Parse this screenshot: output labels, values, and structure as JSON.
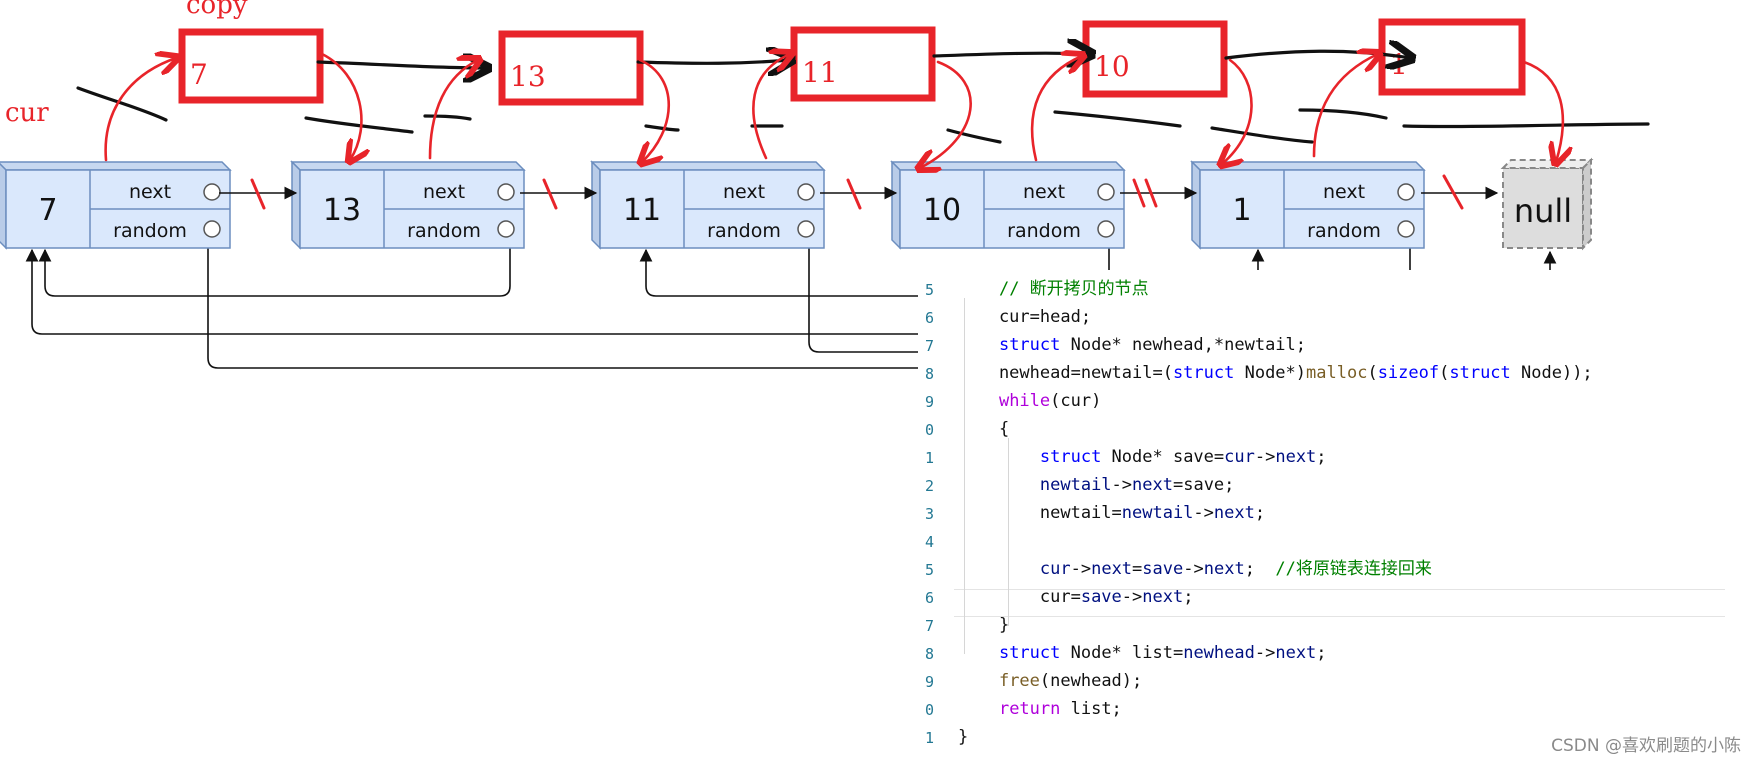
{
  "annotations": {
    "copy_label": "copy",
    "cur_label": "cur"
  },
  "copies": [
    {
      "value": "7"
    },
    {
      "value": "13"
    },
    {
      "value": "11"
    },
    {
      "value": "10"
    },
    {
      "value": "1"
    }
  ],
  "nodes": [
    {
      "value": "7",
      "next_label": "next",
      "random_label": "random"
    },
    {
      "value": "13",
      "next_label": "next",
      "random_label": "random"
    },
    {
      "value": "11",
      "next_label": "next",
      "random_label": "random"
    },
    {
      "value": "10",
      "next_label": "next",
      "random_label": "random"
    },
    {
      "value": "1",
      "next_label": "next",
      "random_label": "random"
    }
  ],
  "null_label": "null",
  "code": {
    "line_numbers": [
      "5",
      "6",
      "7",
      "8",
      "9",
      "0",
      "1",
      "2",
      "3",
      "4",
      "5",
      "6",
      "7",
      "8",
      "9",
      "0",
      "1"
    ],
    "lines": [
      [
        {
          "t": "    "
        },
        {
          "t": "// 断开拷贝的节点",
          "c": "cm"
        }
      ],
      [
        {
          "t": "    cur=head;"
        }
      ],
      [
        {
          "t": "    "
        },
        {
          "t": "struct",
          "c": "kw"
        },
        {
          "t": " Node* newhead,*newtail;"
        }
      ],
      [
        {
          "t": "    newhead=newtail=("
        },
        {
          "t": "struct",
          "c": "kw"
        },
        {
          "t": " Node*)"
        },
        {
          "t": "malloc",
          "c": "fn"
        },
        {
          "t": "("
        },
        {
          "t": "sizeof",
          "c": "kw"
        },
        {
          "t": "("
        },
        {
          "t": "struct",
          "c": "kw"
        },
        {
          "t": " Node));"
        }
      ],
      [
        {
          "t": "    "
        },
        {
          "t": "while",
          "c": "kw2"
        },
        {
          "t": "(cur)"
        }
      ],
      [
        {
          "t": "    {"
        }
      ],
      [
        {
          "t": "        "
        },
        {
          "t": "struct",
          "c": "kw"
        },
        {
          "t": " Node* save="
        },
        {
          "t": "cur",
          "c": "var"
        },
        {
          "t": "->"
        },
        {
          "t": "next",
          "c": "var"
        },
        {
          "t": ";"
        }
      ],
      [
        {
          "t": "        "
        },
        {
          "t": "newtail",
          "c": "var"
        },
        {
          "t": "->"
        },
        {
          "t": "next",
          "c": "var"
        },
        {
          "t": "=save;"
        }
      ],
      [
        {
          "t": "        newtail="
        },
        {
          "t": "newtail",
          "c": "var"
        },
        {
          "t": "->"
        },
        {
          "t": "next",
          "c": "var"
        },
        {
          "t": ";"
        }
      ],
      [
        {
          "t": ""
        }
      ],
      [
        {
          "t": "        "
        },
        {
          "t": "cur",
          "c": "var"
        },
        {
          "t": "->"
        },
        {
          "t": "next",
          "c": "var"
        },
        {
          "t": "="
        },
        {
          "t": "save",
          "c": "var"
        },
        {
          "t": "->"
        },
        {
          "t": "next",
          "c": "var"
        },
        {
          "t": ";  "
        },
        {
          "t": "//将原链表连接回来",
          "c": "cm"
        }
      ],
      [
        {
          "t": "        cur="
        },
        {
          "t": "save",
          "c": "var"
        },
        {
          "t": "->"
        },
        {
          "t": "next",
          "c": "var"
        },
        {
          "t": ";"
        }
      ],
      [
        {
          "t": "    }"
        }
      ],
      [
        {
          "t": "    "
        },
        {
          "t": "struct",
          "c": "kw"
        },
        {
          "t": " Node* list="
        },
        {
          "t": "newhead",
          "c": "var"
        },
        {
          "t": "->"
        },
        {
          "t": "next",
          "c": "var"
        },
        {
          "t": ";"
        }
      ],
      [
        {
          "t": "    "
        },
        {
          "t": "free",
          "c": "fn"
        },
        {
          "t": "(newhead);"
        }
      ],
      [
        {
          "t": "    "
        },
        {
          "t": "return",
          "c": "kw2"
        },
        {
          "t": " list;"
        }
      ],
      [
        {
          "t": "}"
        }
      ]
    ]
  },
  "watermark": "CSDN @喜欢刷题的小陈",
  "colors": {
    "annotation_red": "#e8242a",
    "node_fill": "#dae8fc",
    "node_stroke": "#6c8ebf",
    "ink": "#111111"
  }
}
